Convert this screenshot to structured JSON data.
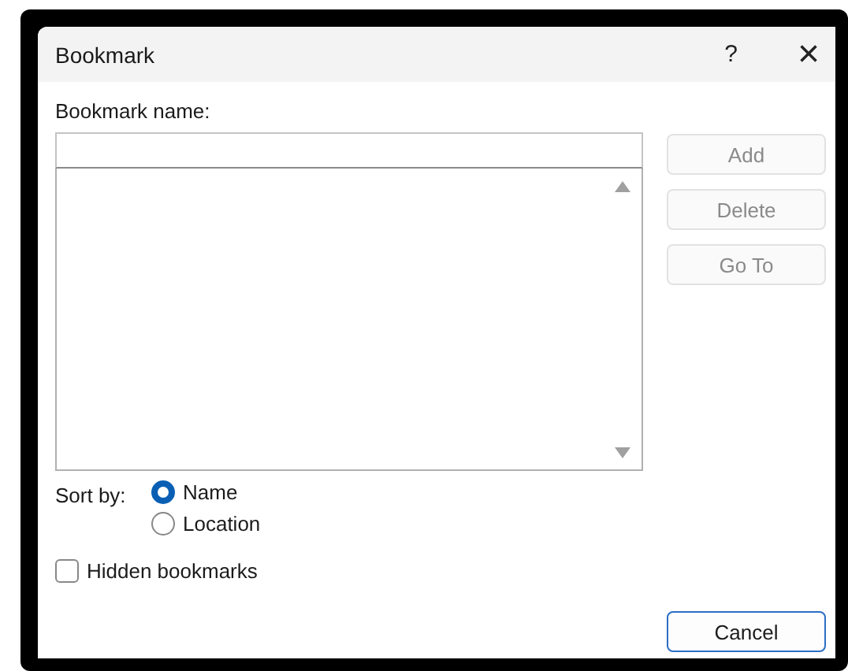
{
  "window": {
    "title": "Bookmark",
    "help": "?",
    "close": "×"
  },
  "bookmark_name": {
    "label": "Bookmark name:"
  },
  "buttons": [
    {
      "label": "Add",
      "disabled": true,
      "default": false
    },
    {
      "label": "Delete",
      "disabled": true,
      "default": false
    },
    {
      "label": "Go To",
      "disabled": true,
      "default": false
    }
  ],
  "sort_by": {
    "label": "Sort by:",
    "options": [
      {
        "label": "Name",
        "selected": true
      },
      {
        "label": "Location",
        "selected": false
      }
    ]
  },
  "hidden_bookmarks": {
    "label": "Hidden bookmarks",
    "checked": false
  },
  "footer_buttons": [
    {
      "label": "Cancel",
      "disabled": false,
      "default": true
    }
  ]
}
